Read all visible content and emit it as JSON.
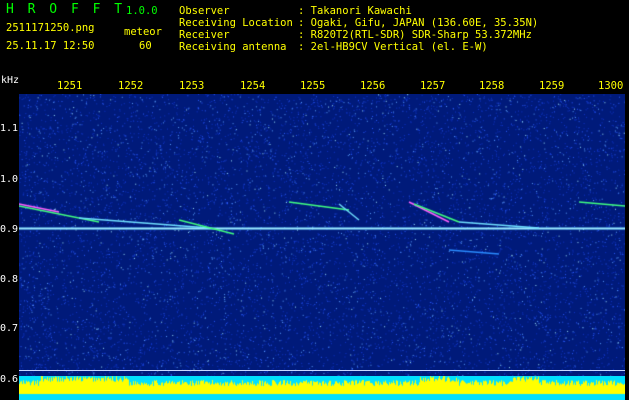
{
  "app": {
    "name": "H R O F F T",
    "version": "1.0.0",
    "filename": "2511171250.png",
    "mode": "meteor",
    "datetime": "25.11.17 12:50",
    "count": "60"
  },
  "info": {
    "rows": [
      {
        "label": "Observer",
        "value": ": Takanori Kawachi"
      },
      {
        "label": "Receiving Location",
        "value": ": Ogaki, Gifu, JAPAN (136.60E, 35.35N)"
      },
      {
        "label": "Receiver",
        "value": ": R820T2(RTL-SDR) SDR-Sharp 53.372MHz"
      },
      {
        "label": "Receiving antenna",
        "value": ": 2el-HB9CV Vertical (el. E-W)"
      }
    ]
  },
  "axis": {
    "y_unit": "kHz",
    "y_ticks": [
      "1.1",
      "1.0",
      "0.9",
      "0.8",
      "0.7",
      "0.6"
    ],
    "x_ticks": [
      "1251",
      "1252",
      "1253",
      "1254",
      "1255",
      "1256",
      "1257",
      "1258",
      "1259",
      "1300"
    ]
  },
  "colors": {
    "title": "#00ff00",
    "label": "#ffff00",
    "text": "#ffffff",
    "background": "#001a7a",
    "bottom_fill": "#00e0ff",
    "bottom_peaks": "#ffff00"
  }
}
